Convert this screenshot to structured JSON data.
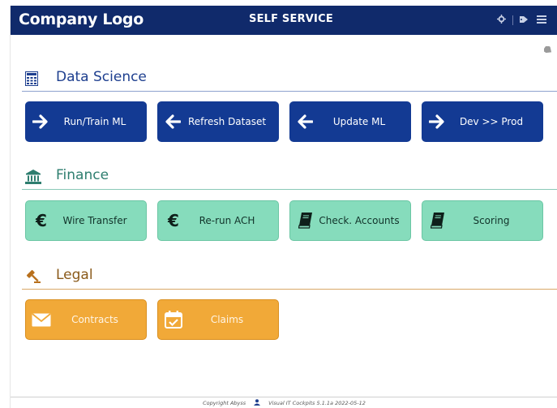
{
  "header": {
    "logo_text": "Company Logo",
    "app_title": "SELF SERVICE",
    "bg_color": "#102a6b",
    "icons": [
      "gear-icon",
      "tags-icon",
      "list-icon"
    ]
  },
  "sections": {
    "data_science": {
      "title": "Data Science",
      "icon": "calculator-icon",
      "color": "#1e3f8f",
      "tiles": [
        {
          "label": "Run/Train ML",
          "icon": "arrow-right-icon"
        },
        {
          "label": "Refresh Dataset",
          "icon": "arrow-left-icon"
        },
        {
          "label": "Update ML",
          "icon": "arrow-left-icon"
        },
        {
          "label": "Dev >> Prod",
          "icon": "arrow-right-icon"
        }
      ]
    },
    "finance": {
      "title": "Finance",
      "icon": "bank-icon",
      "color": "#2e7e6f",
      "tiles": [
        {
          "label": "Wire Transfer",
          "icon": "euro-icon"
        },
        {
          "label": "Re-run ACH",
          "icon": "euro-icon"
        },
        {
          "label": "Check. Accounts",
          "icon": "book-icon"
        },
        {
          "label": "Scoring",
          "icon": "book-icon"
        }
      ]
    },
    "legal": {
      "title": "Legal",
      "icon": "gavel-icon",
      "color": "#8a5a1a",
      "tiles": [
        {
          "label": "Contracts",
          "icon": "envelope-icon"
        },
        {
          "label": "Claims",
          "icon": "calendar-check-icon"
        }
      ]
    }
  },
  "footer": {
    "copyright": "Copyright Abyss",
    "version": "Visual IT Cockpits 5.1.1a 2022-05-12"
  }
}
